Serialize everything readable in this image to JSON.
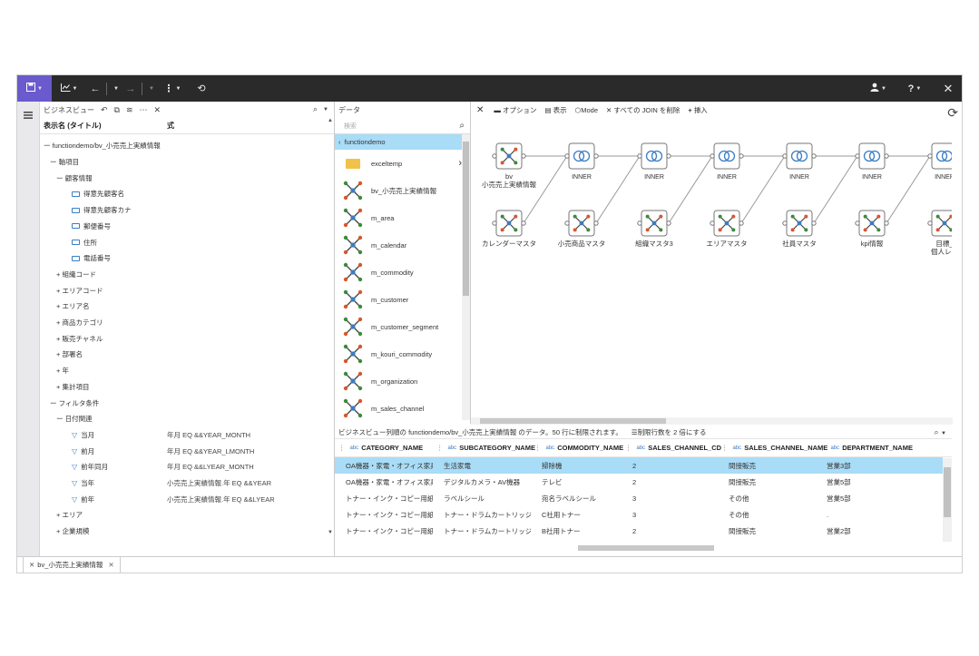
{
  "toolbar": {
    "nav_back": "←",
    "nav_forward": "→",
    "more": "⋮",
    "refresh": "⟲",
    "help": "?",
    "close": "✕"
  },
  "business_view": {
    "title": "ビジネスビュー",
    "col_name": "表示名 (タイトル)",
    "col_expr": "式",
    "rows": [
      {
        "label": "ー functiondemo/bv_小売売上実績情報",
        "indent": 0,
        "kind": "text",
        "expr": ""
      },
      {
        "label": "ー 軸項目",
        "indent": 1,
        "kind": "text",
        "expr": ""
      },
      {
        "label": "ー 顧客情報",
        "indent": 2,
        "kind": "text",
        "expr": ""
      },
      {
        "label": "得意先顧客名",
        "indent": 3,
        "kind": "field",
        "expr": ""
      },
      {
        "label": "得意先顧客カナ",
        "indent": 3,
        "kind": "field",
        "expr": ""
      },
      {
        "label": "郵便番号",
        "indent": 3,
        "kind": "field",
        "expr": ""
      },
      {
        "label": "住所",
        "indent": 3,
        "kind": "field",
        "expr": ""
      },
      {
        "label": "電話番号",
        "indent": 3,
        "kind": "field",
        "expr": ""
      },
      {
        "label": "+ 組織コード",
        "indent": 2,
        "kind": "text",
        "expr": ""
      },
      {
        "label": "+ エリアコード",
        "indent": 2,
        "kind": "text",
        "expr": ""
      },
      {
        "label": "+ エリア名",
        "indent": 2,
        "kind": "text",
        "expr": ""
      },
      {
        "label": "+ 商品カテゴリ",
        "indent": 2,
        "kind": "text",
        "expr": ""
      },
      {
        "label": "+ 販売チャネル",
        "indent": 2,
        "kind": "text",
        "expr": ""
      },
      {
        "label": "+ 部署名",
        "indent": 2,
        "kind": "text",
        "expr": ""
      },
      {
        "label": "+ 年",
        "indent": 2,
        "kind": "text",
        "expr": ""
      },
      {
        "label": "+ 集計項目",
        "indent": 2,
        "kind": "text",
        "expr": ""
      },
      {
        "label": "ー フィルタ条件",
        "indent": 1,
        "kind": "text",
        "expr": ""
      },
      {
        "label": "ー 日付関連",
        "indent": 2,
        "kind": "text",
        "expr": ""
      },
      {
        "label": "当月",
        "indent": 3,
        "kind": "filter",
        "expr": "年月 EQ &&YEAR_MONTH"
      },
      {
        "label": "前月",
        "indent": 3,
        "kind": "filter",
        "expr": "年月 EQ &&YEAR_LMONTH"
      },
      {
        "label": "前年同月",
        "indent": 3,
        "kind": "filter",
        "expr": "年月 EQ &&LYEAR_MONTH"
      },
      {
        "label": "当年",
        "indent": 3,
        "kind": "filter",
        "expr": "小売売上実績情報.年 EQ &&YEAR"
      },
      {
        "label": "前年",
        "indent": 3,
        "kind": "filter",
        "expr": "小売売上実績情報.年 EQ &&LYEAR"
      },
      {
        "label": "+ エリア",
        "indent": 2,
        "kind": "text",
        "expr": ""
      },
      {
        "label": "+ 企業規模",
        "indent": 2,
        "kind": "text",
        "expr": ""
      },
      {
        "label": "+ 取引実績",
        "indent": 2,
        "kind": "text",
        "expr": ""
      }
    ]
  },
  "data_panel": {
    "title": "データ",
    "search_placeholder": "検索",
    "breadcrumb": "functiondemo",
    "items": [
      {
        "label": "exceltemp",
        "kind": "folder"
      },
      {
        "label": "bv_小売売上実績情報",
        "kind": "source"
      },
      {
        "label": "m_area",
        "kind": "source"
      },
      {
        "label": "m_calendar",
        "kind": "source"
      },
      {
        "label": "m_commodity",
        "kind": "source"
      },
      {
        "label": "m_customer",
        "kind": "source"
      },
      {
        "label": "m_customer_segment",
        "kind": "source"
      },
      {
        "label": "m_kouri_commodity",
        "kind": "source"
      },
      {
        "label": "m_organization",
        "kind": "source"
      },
      {
        "label": "m_sales_channel",
        "kind": "source"
      }
    ]
  },
  "join_toolbar": {
    "options": "オプション",
    "display": "表示",
    "mode": "Mode",
    "delete_joins": "すべての JOIN を削除",
    "insert": "挿入"
  },
  "join_diagram": {
    "primary_node": "bv\n小売売上実績情報",
    "joins": [
      "INNER",
      "INNER",
      "INNER",
      "INNER",
      "INNER",
      "INNER"
    ],
    "secondary_nodes": [
      "カレンダーマスタ",
      "小売商品マスタ",
      "組織マスタ3",
      "エリアマスタ",
      "社員マスタ",
      "kpi情報",
      "目標_\n個人レベ"
    ]
  },
  "grid": {
    "message": "ビジネスビュー列順の functiondemo/bv_小売売上実績情報 のデータ。50 行に制限されます。",
    "limit_label": "制限行数を 2 倍にする",
    "columns": [
      "CATEGORY_NAME",
      "SUBCATEGORY_NAME",
      "COMMODITY_NAME",
      "SALES_CHANNEL_CD",
      "SALES_CHANNEL_NAME",
      "DEPARTMENT_NAME"
    ],
    "rows": [
      [
        "OA機器・家電・オフィス家具",
        "生活家電",
        "掃除機",
        "2",
        "間接販売",
        "営業3部"
      ],
      [
        "OA機器・家電・オフィス家具",
        "デジタルカメラ・AV機器",
        "テレビ",
        "2",
        "間接販売",
        "営業5部"
      ],
      [
        "トナー・インク・コピー用紙",
        "ラベルシール",
        "宛名ラベルシール",
        "3",
        "その他",
        "営業5部"
      ],
      [
        "トナー・インク・コピー用紙",
        "トナー・ドラムカートリッジ",
        "C社用トナー",
        "3",
        "その他",
        "."
      ],
      [
        "トナー・インク・コピー用紙",
        "トナー・ドラムカートリッジ",
        "B社用トナー",
        "2",
        "間接販売",
        "営業2部"
      ]
    ]
  },
  "tab": {
    "label": "bv_小売売上実績情報"
  }
}
